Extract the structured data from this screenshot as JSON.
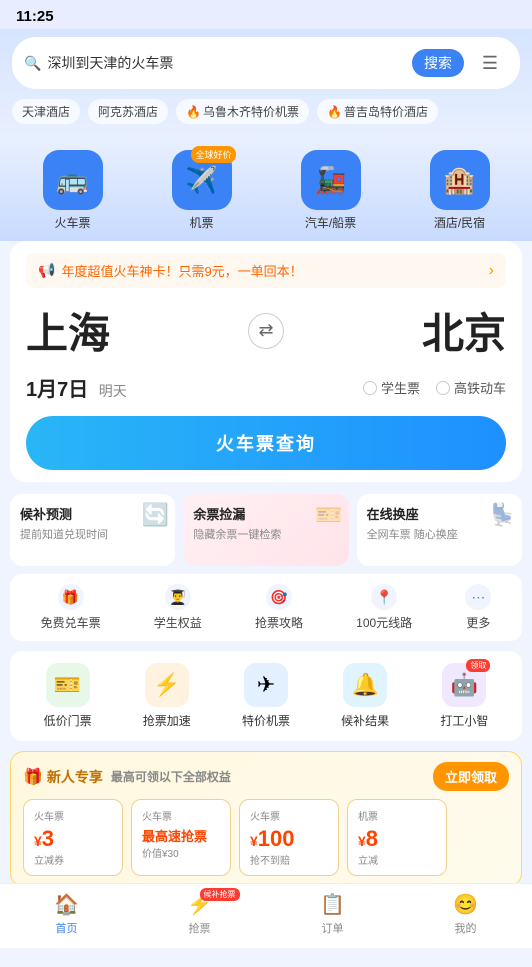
{
  "statusBar": {
    "time": "11:25"
  },
  "searchBar": {
    "placeholder": "深圳到天津的火车票",
    "searchLabel": "搜索"
  },
  "quickTags": [
    {
      "label": "天津酒店",
      "fire": false
    },
    {
      "label": "阿克苏酒店",
      "fire": false
    },
    {
      "label": "乌鲁木齐特价机票",
      "fire": true
    },
    {
      "label": "普吉岛特价酒店",
      "fire": true
    }
  ],
  "navItems": [
    {
      "id": "train",
      "icon": "🚌",
      "label": "火车票",
      "badge": null
    },
    {
      "id": "flight",
      "icon": "✈️",
      "label": "机票",
      "badge": "全球好价"
    },
    {
      "id": "bus",
      "icon": "🚂",
      "label": "汽车/船票",
      "badge": null
    },
    {
      "id": "hotel",
      "icon": "🏨",
      "label": "酒店/民宿",
      "badge": null
    }
  ],
  "promoBanner": {
    "text": "年度超值火车神卡！只需9元，一单回本！",
    "icon": "📢"
  },
  "route": {
    "from": "上海",
    "to": "北京",
    "swapLabel": "⇄"
  },
  "date": {
    "day": "1月7日",
    "weekday": "明天"
  },
  "ticketOptions": [
    {
      "label": "学生票"
    },
    {
      "label": "高铁动车"
    }
  ],
  "searchButton": {
    "label": "火车票查询"
  },
  "featureCards": [
    {
      "title": "候补预测",
      "desc": "提前知道兑现时间",
      "icon": "🔄",
      "style": "normal"
    },
    {
      "title": "余票捡漏",
      "desc": "隐藏余票一键检索",
      "icon": "🎫",
      "style": "pink"
    },
    {
      "title": "在线换座",
      "desc": "全网车票 随心换座",
      "icon": "💺",
      "style": "normal"
    }
  ],
  "subFeatures": [
    {
      "label": "免费兑车票",
      "icon": "🎁"
    },
    {
      "label": "学生权益",
      "icon": "👨‍🎓"
    },
    {
      "label": "抢票攻略",
      "icon": "🎯"
    },
    {
      "label": "100元线路",
      "icon": "📍"
    },
    {
      "label": "更多",
      "icon": "⋯"
    }
  ],
  "appItems": [
    {
      "label": "低价门票",
      "icon": "🎫",
      "style": "green",
      "badge": null
    },
    {
      "label": "抢票加速",
      "icon": "⚡",
      "style": "orange",
      "badge": null
    },
    {
      "label": "特价机票",
      "icon": "✈",
      "style": "blue",
      "badge": null
    },
    {
      "label": "候补结果",
      "icon": "🔔",
      "style": "lblue",
      "badge": null
    },
    {
      "label": "打工小智",
      "icon": "🤖",
      "style": "robot",
      "badge": "领取"
    }
  ],
  "promoSection": {
    "titleIcon": "🎁",
    "title": "新人专享",
    "subtitle": "最高可领以下全部权益",
    "claimLabel": "立即领取",
    "cards": [
      {
        "type": "火车票",
        "amount": "3",
        "unit": "¥",
        "desc": "立减券",
        "highlight": false
      },
      {
        "type": "火车票",
        "amount": null,
        "unit": null,
        "desc": "价值¥30",
        "highlight": true,
        "highlightText": "最高速抢票"
      },
      {
        "type": "火车票",
        "amount": "100",
        "unit": "¥",
        "desc": "抢不到赔",
        "highlight": false
      },
      {
        "type": "机票",
        "amount": "8",
        "unit": "¥",
        "desc": "立减",
        "highlight": false
      }
    ]
  },
  "bottomNav": [
    {
      "id": "home",
      "icon": "🏠",
      "label": "首页",
      "active": true,
      "badge": null
    },
    {
      "id": "grab",
      "icon": "⚡",
      "label": "抢票",
      "active": false,
      "badge": "候补抢票"
    },
    {
      "id": "orders",
      "icon": "📋",
      "label": "订单",
      "active": false,
      "badge": null
    },
    {
      "id": "me",
      "icon": "😊",
      "label": "我的",
      "active": false,
      "badge": null
    }
  ]
}
